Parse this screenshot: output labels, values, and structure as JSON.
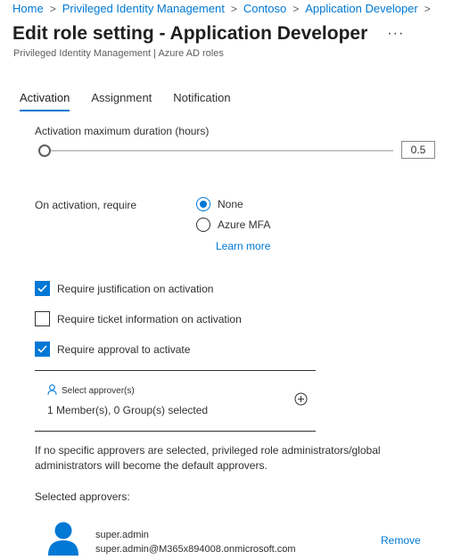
{
  "breadcrumb": [
    "Home",
    "Privileged Identity Management",
    "Contoso",
    "Application Developer"
  ],
  "header": {
    "title": "Edit role setting - Application Developer",
    "more": "···",
    "subtitle": "Privileged Identity Management | Azure AD roles"
  },
  "tabs": [
    {
      "label": "Activation",
      "active": true
    },
    {
      "label": "Assignment",
      "active": false
    },
    {
      "label": "Notification",
      "active": false
    }
  ],
  "activation": {
    "duration_label": "Activation maximum duration (hours)",
    "duration_value": "0.5",
    "require_label": "On activation, require",
    "options": [
      {
        "label": "None",
        "checked": true
      },
      {
        "label": "Azure MFA",
        "checked": false
      }
    ],
    "learn_more": "Learn more"
  },
  "checkboxes": [
    {
      "label": "Require justification on activation",
      "checked": true
    },
    {
      "label": "Require ticket information on activation",
      "checked": false
    },
    {
      "label": "Require approval to activate",
      "checked": true
    }
  ],
  "approvers": {
    "select_label": "Select approver(s)",
    "count_text": "1 Member(s), 0 Group(s) selected",
    "note": "If no specific approvers are selected, privileged role administrators/global administrators will become the default approvers.",
    "selected_label": "Selected approvers:",
    "list": [
      {
        "name": "super.admin",
        "email": "super.admin@M365x894008.onmicrosoft.com",
        "action": "Remove"
      }
    ]
  },
  "colors": {
    "accent": "#0078d4",
    "avatar": "#0078d4"
  }
}
